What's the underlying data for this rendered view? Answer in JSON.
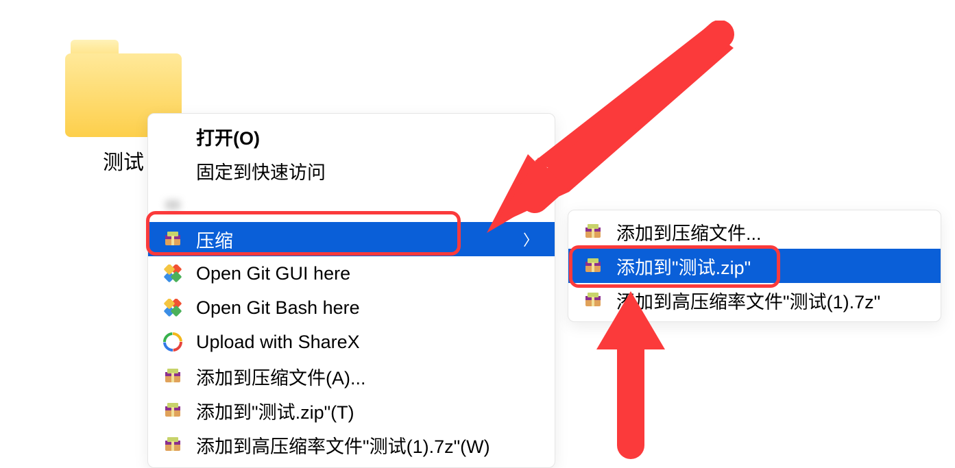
{
  "folder": {
    "label": "测试"
  },
  "menu": {
    "items": [
      {
        "label": "打开(O)"
      },
      {
        "label": "固定到快速访问"
      },
      {
        "label": ""
      },
      {
        "label": "压缩"
      },
      {
        "label": "Open Git GUI here"
      },
      {
        "label": "Open Git Bash here"
      },
      {
        "label": "Upload with ShareX"
      },
      {
        "label": "添加到压缩文件(A)..."
      },
      {
        "label": "添加到\"测试.zip\"(T)"
      },
      {
        "label": "添加到高压缩率文件\"测试(1).7z\"(W)"
      }
    ]
  },
  "submenu": {
    "items": [
      {
        "label": "添加到压缩文件..."
      },
      {
        "label": "添加到\"测试.zip\""
      },
      {
        "label": "添加到高压缩率文件\"测试(1).7z\""
      }
    ]
  },
  "colors": {
    "highlight": "#0a5fd8",
    "emphasis": "#fb3a3b"
  }
}
